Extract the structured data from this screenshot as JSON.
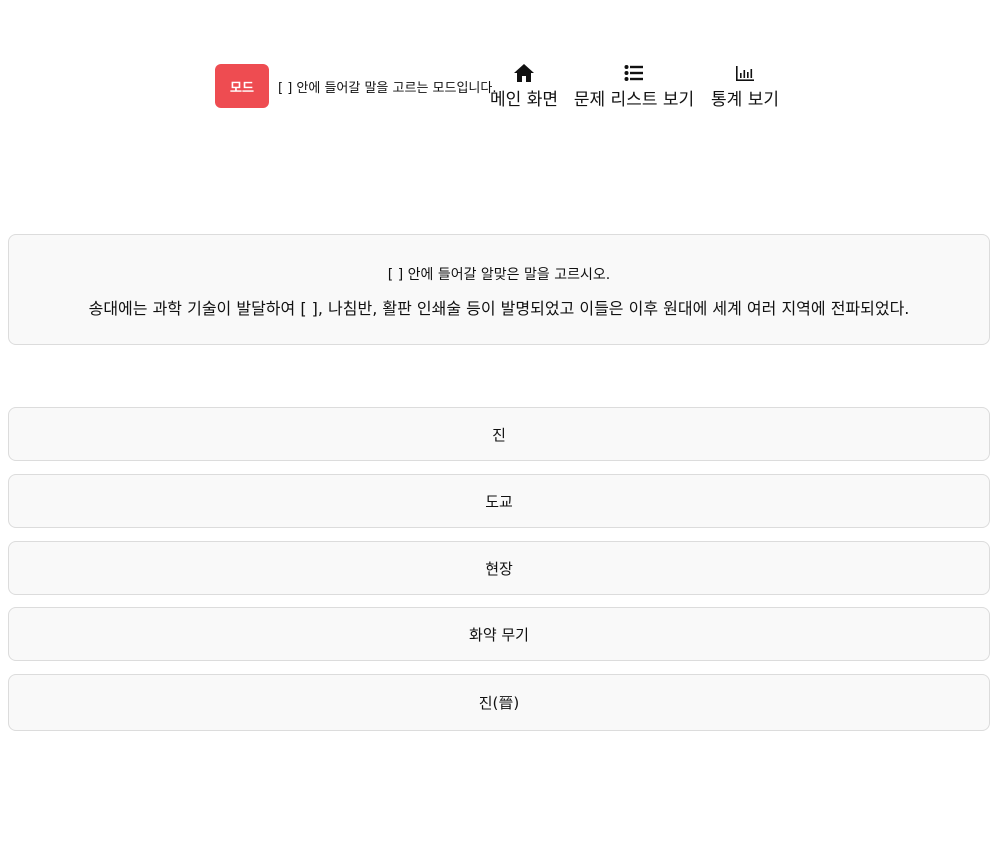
{
  "header": {
    "mode_button_label": "모드",
    "mode_description": "[ ] 안에 들어갈 말을 고르는 모드입니다.",
    "nav": [
      {
        "label": "메인 화면",
        "icon": "home-icon"
      },
      {
        "label": "문제 리스트 보기",
        "icon": "list-icon"
      },
      {
        "label": "통계 보기",
        "icon": "bar-chart-icon"
      }
    ]
  },
  "question": {
    "instruction": "[ ] 안에 들어갈 알맞은 말을 고르시오.",
    "text": "송대에는 과학 기술이 발달하여 [ ], 나침반, 활판 인쇄술 등이 발명되었고 이들은 이후 원대에 세계 여러 지역에 전파되었다."
  },
  "options": [
    "진",
    "도교",
    "현장",
    "화약 무기",
    "진(晉)"
  ],
  "colors": {
    "mode_button_bg": "#ee4c51",
    "panel_bg": "#f9f9f9",
    "panel_border": "#dcdcdc"
  }
}
